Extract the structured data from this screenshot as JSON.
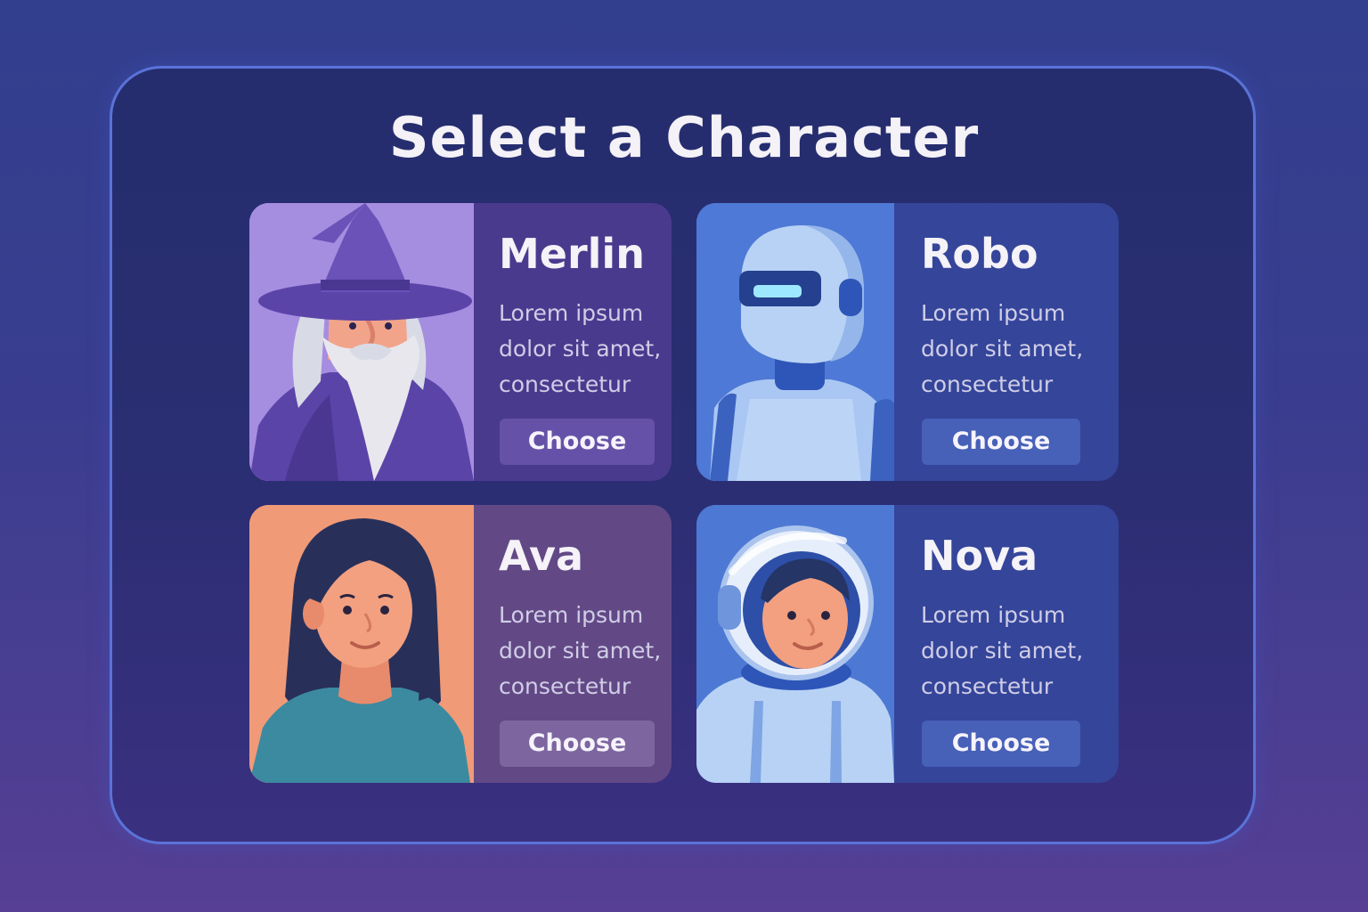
{
  "screen": {
    "title": "Select a Character"
  },
  "characters": [
    {
      "name": "Merlin",
      "description_lines": [
        "Lorem ipsum",
        "dolor sit amet,",
        "consectetur"
      ],
      "button_label": "Choose",
      "portrait_icon": "wizard-portrait-icon",
      "colors": {
        "art_bg": "#a58de0",
        "info_bg": "#4a3a8e",
        "button": "#6552a8"
      }
    },
    {
      "name": "Robo",
      "description_lines": [
        "Lorem ipsum",
        "dolor sit amet,",
        "consectetur"
      ],
      "button_label": "Choose",
      "portrait_icon": "robot-portrait-icon",
      "colors": {
        "art_bg": "#4e79d6",
        "info_bg": "#34459a",
        "button": "#4760b8"
      }
    },
    {
      "name": "Ava",
      "description_lines": [
        "Lorem ipsum",
        "dolor sit amet,",
        "consectetur"
      ],
      "button_label": "Choose",
      "portrait_icon": "woman-portrait-icon",
      "colors": {
        "art_bg": "#f09a78",
        "info_bg": "#624986",
        "button": "#7d66a0"
      }
    },
    {
      "name": "Nova",
      "description_lines": [
        "Lorem ipsum",
        "dolor sit amet,",
        "consectetur"
      ],
      "button_label": "Choose",
      "portrait_icon": "astronaut-portrait-icon",
      "colors": {
        "art_bg": "#4d79d4",
        "info_bg": "#34459a",
        "button": "#4760b8"
      }
    }
  ]
}
